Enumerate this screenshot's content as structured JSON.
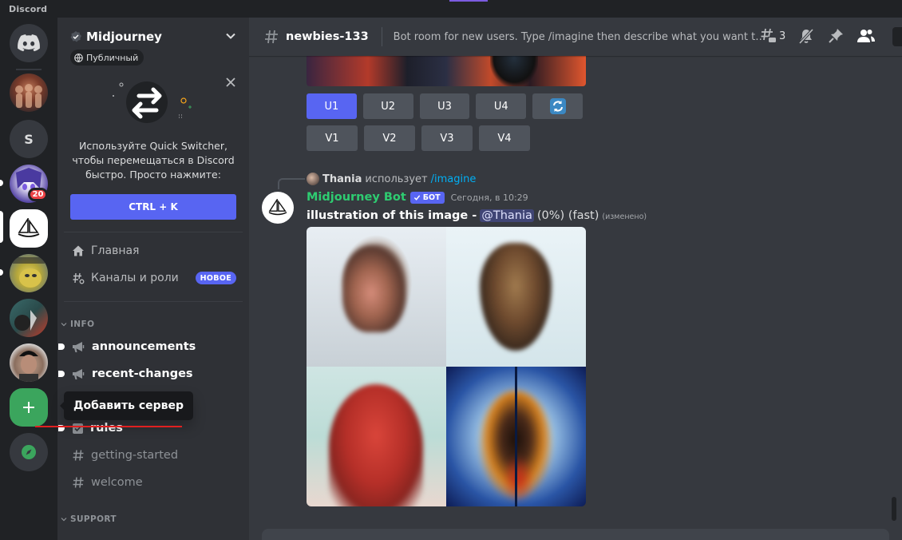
{
  "app": {
    "brand": "Discord"
  },
  "servers": [
    {
      "key": "server-1",
      "icon": "server-avatar-icon"
    },
    {
      "key": "server-s",
      "letter": "S"
    },
    {
      "key": "server-anime",
      "badge": "20"
    },
    {
      "key": "server-midjourney",
      "icon": "boat-icon"
    },
    {
      "key": "server-meme"
    },
    {
      "key": "server-dark"
    },
    {
      "key": "server-man"
    }
  ],
  "add_server_tooltip": "Добавить сервер",
  "guild": {
    "name": "Midjourney",
    "public_label": "Публичный"
  },
  "quick_switcher": {
    "text": "Используйте Quick Switcher, чтобы перемещаться в Discord быстро. Просто нажмите:",
    "shortcut": "CTRL + K"
  },
  "nav": {
    "home": "Главная",
    "channels_roles": "Каналы и роли",
    "new_badge": "НОВОЕ"
  },
  "categories": {
    "info": "INFO",
    "support": "SUPPORT"
  },
  "channels_info": [
    {
      "name": "announcements",
      "type": "announcement",
      "unread": true
    },
    {
      "name": "recent-changes",
      "type": "announcement",
      "unread": true
    },
    {
      "name": "rules",
      "type": "rules",
      "unread": true
    },
    {
      "name": "getting-started",
      "type": "text",
      "unread": false
    },
    {
      "name": "welcome",
      "type": "text",
      "unread": false
    }
  ],
  "channel": {
    "name": "newbies-133",
    "topic": "Bot room for new users. Type /imagine then describe what you want to draw...",
    "threads_count": "3"
  },
  "upscale_buttons": {
    "row1": [
      "U1",
      "U2",
      "U3",
      "U4"
    ],
    "row2": [
      "V1",
      "V2",
      "V3",
      "V4"
    ]
  },
  "message": {
    "reply_user": "Thania",
    "reply_text": "использует",
    "reply_command": "/imagine",
    "author": "Midjourney Bot",
    "bot_tag": "БОТ",
    "timestamp": "Сегодня, в 10:29",
    "prompt": "illustration of this image -",
    "mention": "@Thania",
    "progress": "(0%) (fast)",
    "edited": "(изменено)"
  },
  "colors": {
    "blurple": "#5865f2",
    "bot_green": "#2ecc71",
    "link": "#00aff4",
    "danger": "#ed4245"
  }
}
